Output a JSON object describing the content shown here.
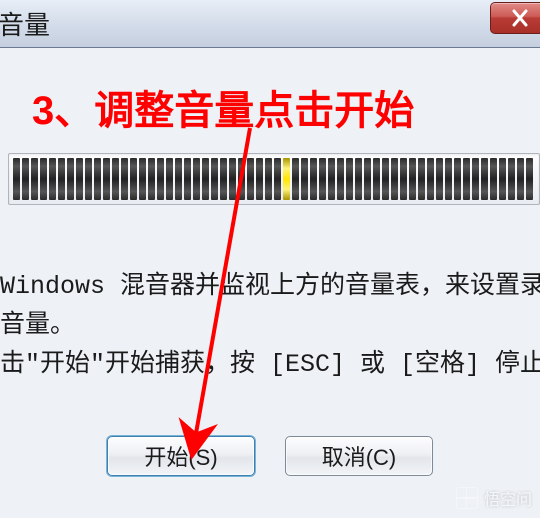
{
  "window": {
    "title_fragment": "音量"
  },
  "annotation": {
    "text": "3、调整音量点击开始",
    "color": "#ff0000"
  },
  "meter": {
    "total_ticks": 60,
    "active_index": 30
  },
  "instructions": {
    "line1": "Windows 混音器并监视上方的音量表，来设置录",
    "line2": "音量。",
    "line3": "击\"开始\"开始捕获，按 [ESC] 或 [空格] 停止"
  },
  "buttons": {
    "start": "开始(S)",
    "cancel": "取消(C)"
  },
  "watermark": {
    "text": "悟空问"
  }
}
